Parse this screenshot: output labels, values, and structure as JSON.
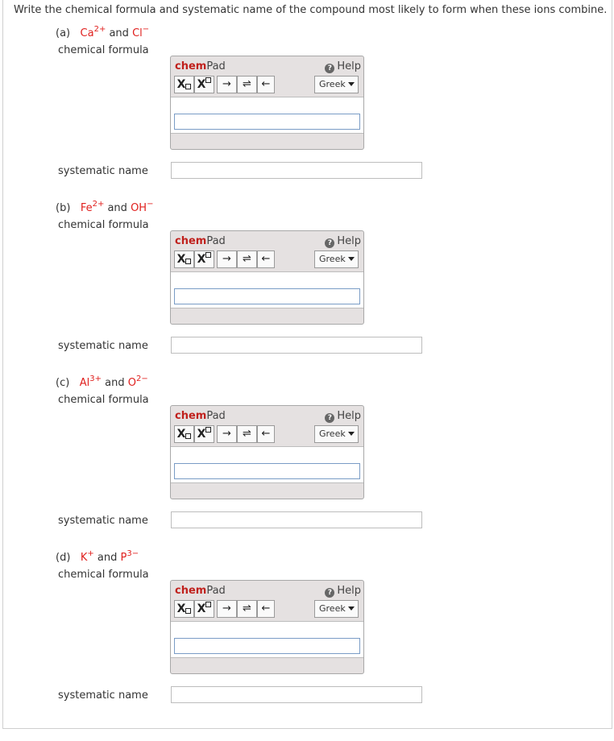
{
  "prompt": "Write the chemical formula and systematic name of the compound most likely to form when these ions combine.",
  "chempad": {
    "title_chem": "chem",
    "title_pad": "Pad",
    "help_label": "Help",
    "help_icon_glyph": "?",
    "sub_button": "X",
    "sup_button": "X",
    "arrow_right": "→",
    "arrow_equilibrium": "⇌",
    "arrow_left": "←",
    "greek_label": "Greek"
  },
  "labels": {
    "chemical_formula": "chemical formula",
    "systematic_name": "systematic name",
    "and": "and"
  },
  "questions": [
    {
      "letter": "(a)",
      "cation": "Ca",
      "cation_charge": "2+",
      "anion": "Cl",
      "anion_charge": "−"
    },
    {
      "letter": "(b)",
      "cation": "Fe",
      "cation_charge": "2+",
      "anion": "OH",
      "anion_charge": "−"
    },
    {
      "letter": "(c)",
      "cation": "Al",
      "cation_charge": "3+",
      "anion": "O",
      "anion_charge": "2−"
    },
    {
      "letter": "(d)",
      "cation": "K",
      "cation_charge": "+",
      "anion": "P",
      "anion_charge": "3−"
    }
  ],
  "colors": {
    "ion": "#e0201e",
    "chem_brand": "#c0211d",
    "input_border": "#7a9cc6"
  }
}
